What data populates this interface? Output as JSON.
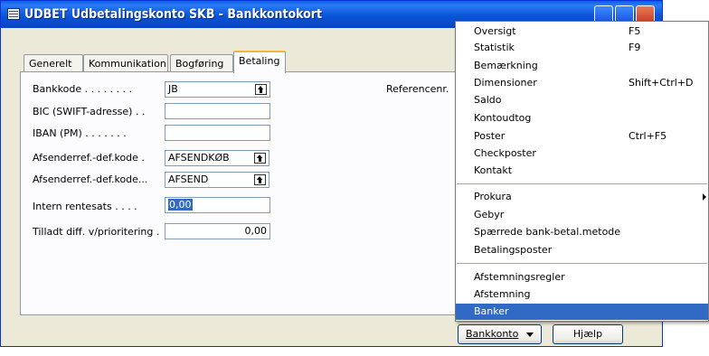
{
  "window": {
    "title": "UDBET Udbetalingskonto SKB - Bankkontokort"
  },
  "tabs": [
    "Generelt",
    "Kommunikation",
    "Bogføring",
    "Betaling"
  ],
  "active_tab": "Betaling",
  "fields": {
    "bankkode": {
      "label": "Bankkode . . . . . . . .",
      "value": "JB"
    },
    "bic": {
      "label": "BIC (SWIFT-adresse) . .",
      "value": ""
    },
    "iban": {
      "label": "IBAN (PM) . . . . . . .",
      "value": ""
    },
    "afsenderref1": {
      "label": "Afsenderref.-def.kode  .",
      "value": "AFSENDKØB"
    },
    "afsenderref2": {
      "label": "Afsenderref.-def.kode...",
      "value": "AFSEND"
    },
    "intern_rentesats": {
      "label": "Intern rentesats  . . . .",
      "value": "0,00"
    },
    "tilladt_diff": {
      "label": "Tilladt diff. v/prioritering .",
      "value": "0,00"
    },
    "referencenr": {
      "label": "Referencenr."
    }
  },
  "menu": {
    "items": [
      {
        "label": "Oversigt",
        "shortcut": "F5"
      },
      {
        "label": "Statistik",
        "shortcut": "F9"
      },
      {
        "label": "Bemærkning",
        "shortcut": ""
      },
      {
        "label": "Dimensioner",
        "shortcut": "Shift+Ctrl+D"
      },
      {
        "label": "Saldo",
        "shortcut": ""
      },
      {
        "label": "Kontoudtog",
        "shortcut": ""
      },
      {
        "label": "Poster",
        "shortcut": "Ctrl+F5"
      },
      {
        "label": "Checkposter",
        "shortcut": ""
      },
      {
        "label": "Kontakt",
        "shortcut": ""
      },
      {
        "label": "Prokura",
        "shortcut": ""
      },
      {
        "label": "Gebyr",
        "shortcut": ""
      },
      {
        "label": "Spærrede bank-betal.metode",
        "shortcut": ""
      },
      {
        "label": "Betalingsposter",
        "shortcut": ""
      },
      {
        "label": "Afstemningsregler",
        "shortcut": ""
      },
      {
        "label": "Afstemning",
        "shortcut": ""
      },
      {
        "label": "Banker",
        "shortcut": ""
      }
    ],
    "highlighted": "Banker"
  },
  "buttons": {
    "bankkonto": "Bankkonto",
    "hjaelp": "Hjælp"
  },
  "colors": {
    "title_bar": "#0a5ee8",
    "highlight": "#316ac5",
    "active_tab_accent": "#f7b53c"
  }
}
